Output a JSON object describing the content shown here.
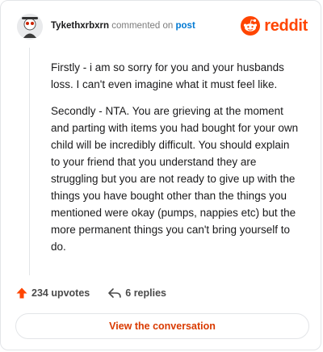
{
  "header": {
    "username": "Tykethxrbxrn",
    "action_text": "commented on",
    "post_link": "post",
    "logo_text": "reddit"
  },
  "comment": {
    "paragraphs": [
      "Firstly - i am so sorry for you and your husbands loss. I can't even imagine what it must feel like.",
      "Secondly - NTA. You are grieving at the moment and parting with items you had bought for your own child will be incredibly difficult. You should explain to your friend that you understand they are struggling but you are not ready to give up with the things you have bought other than the things you mentioned were okay (pumps, nappies etc) but the more permanent things you can't bring yourself to do."
    ]
  },
  "actions": {
    "upvotes": "234 upvotes",
    "replies": "6 replies"
  },
  "footer": {
    "view_button": "View the conversation"
  },
  "colors": {
    "brand": "#ff4500",
    "link": "#0079d3",
    "button_text": "#d93a00"
  }
}
